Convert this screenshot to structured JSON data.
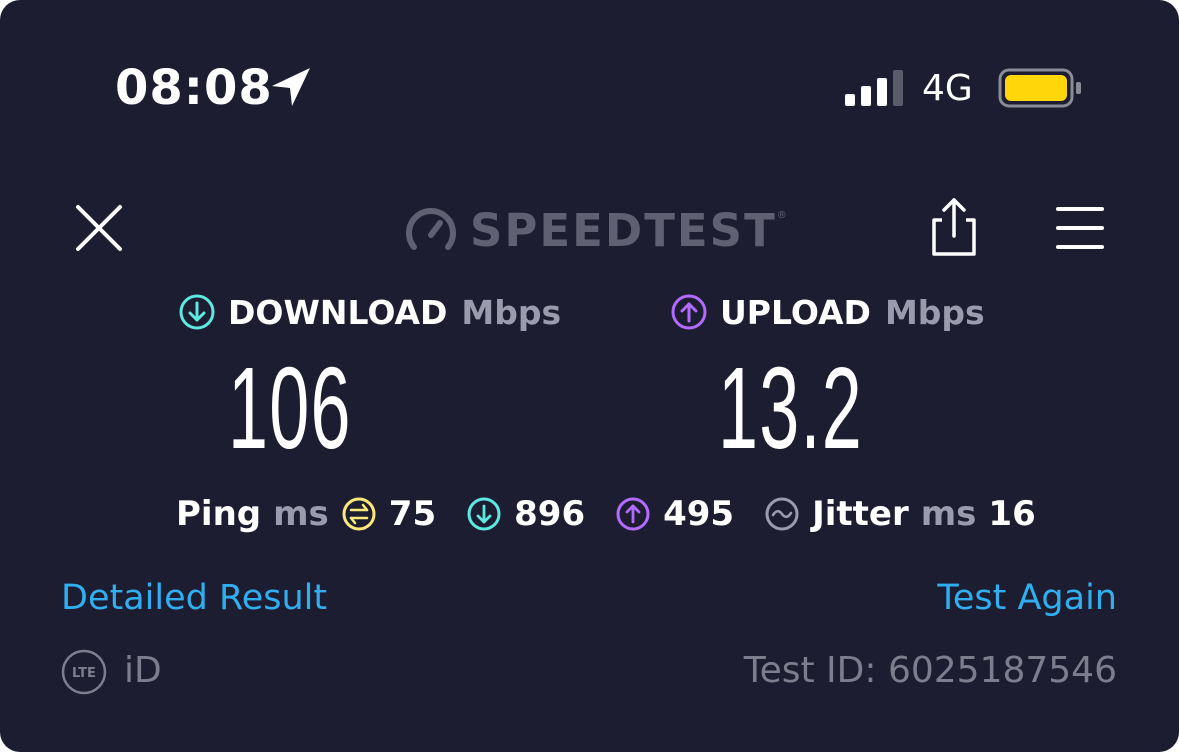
{
  "status_bar": {
    "time": "08:08",
    "network": "4G",
    "icons": [
      "location-arrow-icon",
      "signal-bars-icon",
      "battery-icon"
    ],
    "battery_color": "#ffd60a"
  },
  "header": {
    "logo_text": "SPEEDTEST",
    "icons": [
      "close-icon",
      "speedometer-logo-icon",
      "share-icon",
      "menu-icon"
    ]
  },
  "download": {
    "label": "DOWNLOAD",
    "unit": "Mbps",
    "value": "106",
    "icon": "download-arrow-icon",
    "color": "#5ee8e0"
  },
  "upload": {
    "label": "UPLOAD",
    "unit": "Mbps",
    "value": "13.2",
    "icon": "upload-arrow-icon",
    "color": "#b36bff"
  },
  "stats": {
    "ping_label": "Ping",
    "ping_unit": "ms",
    "idle_ping": "75",
    "idle_color": "#fbe97a",
    "download_ping": "896",
    "upload_ping": "495",
    "jitter_label": "Jitter",
    "jitter_unit": "ms",
    "jitter": "16"
  },
  "links": {
    "detailed_result": "Detailed Result",
    "test_again": "Test Again",
    "color": "#30aef0"
  },
  "footer": {
    "network_badge": "LTE",
    "provider": "iD",
    "test_id": "Test ID: 6025187546"
  }
}
